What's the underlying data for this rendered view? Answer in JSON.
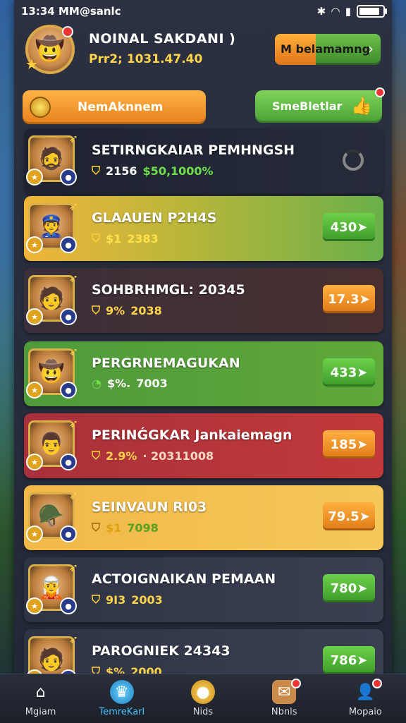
{
  "status": {
    "time": "13:34 MM@sanlc",
    "battery_level": 0.9
  },
  "header": {
    "player_name": "NOINAL SAKDANI )",
    "player_sub": "Prr2; 1031.47.40",
    "action_button": "M belamamng"
  },
  "filters": {
    "left_label": "NemAknnem",
    "right_label": "SmeBletlar"
  },
  "rows": [
    {
      "name": "SETIRNGKAIAR PEMHNGSH",
      "stat1": "2156",
      "stat2": "$50,1000%",
      "button": ""
    },
    {
      "name": "GLAAUEN P2H4S",
      "stat1": "$1",
      "stat2": "2383",
      "button": "430"
    },
    {
      "name": "SOHBRHMGL: 20345",
      "stat1": "9%",
      "stat2": "2038",
      "button": "17.3"
    },
    {
      "name": "PERGRNEMAGUKAN",
      "stat1": "$%.",
      "stat2": "7003",
      "button": "433"
    },
    {
      "name": "PERINǴGKAR Jankaiemagn",
      "stat1": "2.9%",
      "stat2": "· 20311008",
      "button": "185"
    },
    {
      "name": "SEINVAUN RI03",
      "stat1": "$1",
      "stat2": "7098",
      "button": "79.5"
    },
    {
      "name": "ACTOIGNAIKAN PEMAAN",
      "stat1": "9I3",
      "stat2": "2003",
      "button": "780"
    },
    {
      "name": "PAROGNIEK 24343",
      "stat1": "$%",
      "stat2": "2000",
      "button": "786"
    }
  ],
  "nav": [
    {
      "label": "Mgiam"
    },
    {
      "label": "TemreKarl"
    },
    {
      "label": "Nids"
    },
    {
      "label": "Nbnls"
    },
    {
      "label": "Mopaio"
    }
  ]
}
